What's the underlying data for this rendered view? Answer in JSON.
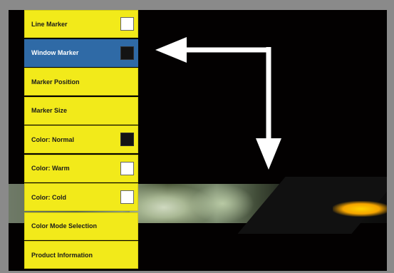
{
  "menu": {
    "items": [
      {
        "label": "Line Marker",
        "checkbox": "off"
      },
      {
        "label": "Window Marker",
        "checkbox": "on",
        "selected": true
      },
      {
        "label": "Marker Position"
      },
      {
        "label": "Marker Size"
      },
      {
        "label": "Color: Normal",
        "checkbox": "on"
      },
      {
        "label": "Color: Warm",
        "checkbox": "off"
      },
      {
        "label": "Color: Cold",
        "checkbox": "off"
      },
      {
        "label": "Color Mode Selection"
      },
      {
        "label": "Product Information"
      }
    ]
  },
  "colors": {
    "menu_bg": "#f2ea1a",
    "selected_bg": "#2f6aa6",
    "screen_bg": "#030101",
    "frame": "#8a8a8a",
    "arrow": "#ffffff"
  },
  "icons": [
    "arrow-left-icon",
    "arrow-down-icon"
  ]
}
